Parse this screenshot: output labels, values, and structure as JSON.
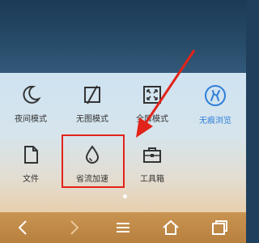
{
  "menu": {
    "items": [
      {
        "label": "夜间模式",
        "icon": "moon-icon"
      },
      {
        "label": "无图模式",
        "icon": "no-image-icon"
      },
      {
        "label": "全屏模式",
        "icon": "fullscreen-icon"
      },
      {
        "label": "无痕浏览",
        "icon": "incognito-icon",
        "active": true
      },
      {
        "label": "文件",
        "icon": "file-icon"
      },
      {
        "label": "省流加速",
        "icon": "water-drop-icon"
      },
      {
        "label": "工具箱",
        "icon": "toolbox-icon"
      }
    ]
  },
  "colors": {
    "active": "#2f7fd8",
    "annotation": "#e2231a",
    "bottom_bar": "#c99451"
  },
  "nav": {
    "back": "chevron-left-icon",
    "forward": "chevron-right-icon",
    "menu": "menu-icon",
    "home": "home-icon",
    "tabs": "tabs-icon"
  }
}
